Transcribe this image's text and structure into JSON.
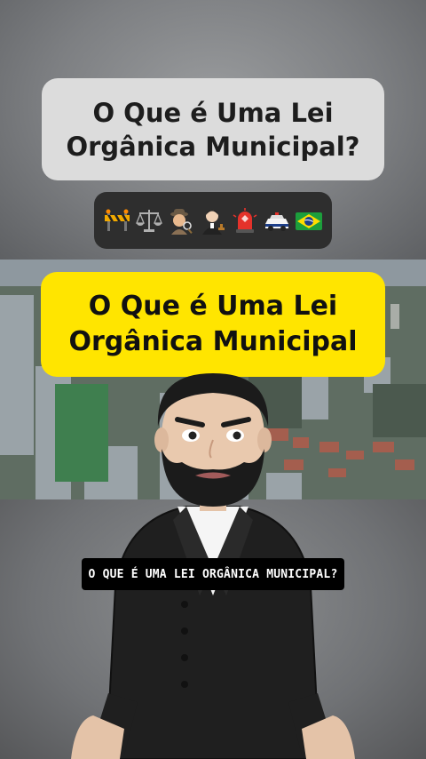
{
  "top_card": {
    "title": "O Que é Uma Lei Orgânica Municipal?"
  },
  "emoji_bar": {
    "icons": [
      "construction-barrier-icon",
      "balance-scale-icon",
      "detective-icon",
      "judge-icon",
      "police-siren-icon",
      "police-car-icon",
      "brazil-flag-icon"
    ]
  },
  "yellow_card": {
    "title": "O Que é Uma Lei Orgânica Municipal"
  },
  "caption": {
    "text": "O QUE É UMA LEI ORGÂNICA MUNICIPAL?"
  },
  "colors": {
    "yellow": "#ffe500",
    "card_gray": "#dcdcdc",
    "emoji_bar_bg": "#2e2e2e",
    "caption_bg": "#000000"
  }
}
